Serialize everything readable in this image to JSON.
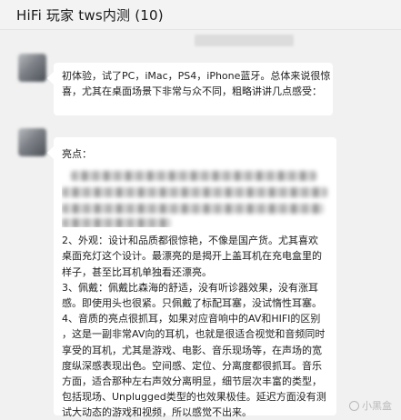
{
  "header": {
    "title": "HiFi 玩家 tws内测 (10)"
  },
  "messages": [
    {
      "text": "初体验，试了PC，iMac，PS4，iPhone蓝牙。总体来说很惊喜，尤其在桌面场景下非常与众不同，粗略讲讲几点感受："
    },
    {
      "lines": [
        "亮点：",
        "2、外观：设计和品质都很惊艳，不像是国产货。尤其喜欢",
        "桌面充灯这个设计。最漂亮的是揭开上盖耳机在充电盒里的",
        "样子，甚至比耳机单独看还漂亮。",
        "3、佩戴：佩戴比森海的舒适，没有听诊器效果，没有涨耳",
        "感。即使用头也很紧。只佩戴了标配耳塞，没试惰性耳塞。",
        "4、音质的亮点很抓耳，如果对应音响中的AV和HIFI的区别",
        "，这是一副非常AV向的耳机，也就是很适合视觉和音频同时",
        "享受的耳机，尤其是游戏、电影、音乐现场等，在声场的宽",
        "度纵深感表现出色。空间感、定位、分离度都很抓耳。音乐",
        "方面，适合那种左右声效分离明显，细节层次丰富的类型，",
        "包括现场、Unplugged类型的也效果极佳。延迟方面没有测",
        "试大动态的游戏和视频，所以感觉不出来。"
      ]
    }
  ],
  "watermark": {
    "text": "小黑盒"
  },
  "colors": {
    "background": "#f1f1f1",
    "bubble": "#ffffff",
    "text": "#222222"
  }
}
